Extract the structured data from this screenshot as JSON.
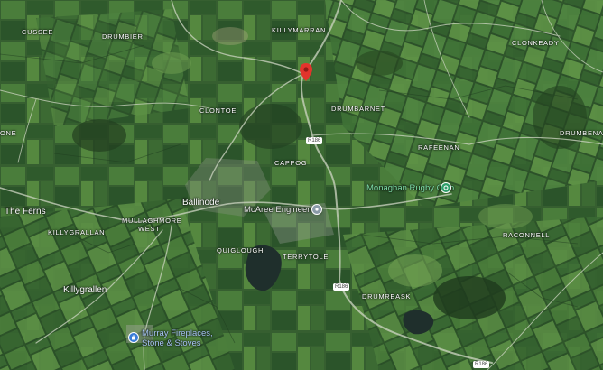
{
  "map": {
    "type": "satellite",
    "colors": {
      "field_dark": "#2e5a2f",
      "field_mid": "#3f7236",
      "field_light": "#5b8c45",
      "hedge": "#1f3d1f",
      "road": "#cfd6c4",
      "water": "#1f2f2c",
      "pin": "#e2342c",
      "poi_green": "#2f9e6a",
      "poi_blue": "#3b7dd8",
      "poi_gray": "#8a9aa8"
    }
  },
  "labels": {
    "cussee": "CUSSEE",
    "drumbier": "DRUMBIER",
    "killymarran": "KILLYMARRAN",
    "clonkeady": "CLONKEADY",
    "clontoe": "CLONTOE",
    "drumbarnet": "DRUMBARNET",
    "one": "ONE",
    "drumbenagh": "DRUMBENAGH",
    "rafeenan": "RAFEENAN",
    "cappog": "CAPPOG",
    "mullaghmore_west_1": "MULLAGHMORE",
    "mullaghmore_west_2": "WEST",
    "killygrallan_upper": "KILLYGRALLAN",
    "quiglough": "QUIGLOUGH",
    "terrytole": "TERRYTOLE",
    "raconnell": "RACONNELL",
    "drumreask": "DRUMREASK"
  },
  "towns": {
    "the_ferns": "The Ferns",
    "ballinode": "Ballinode",
    "killygrallen": "Killygrallen"
  },
  "pois": {
    "rugby_club": "Monaghan Rugby Club",
    "mcaree": "McAree Engineering",
    "murray_line1": "Murray Fireplaces,",
    "murray_line2": "Stone & Stoves"
  },
  "roads": {
    "r186_a": "R186",
    "r186_b": "R186",
    "r186_c": "R186"
  },
  "pin": {
    "icon": "location-pin-icon"
  }
}
